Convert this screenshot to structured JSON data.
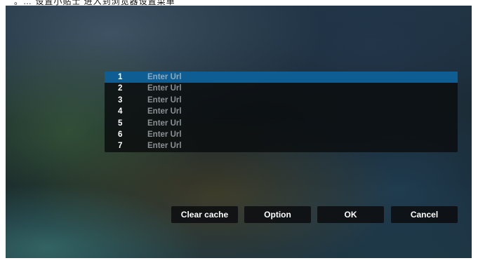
{
  "header_text": "。…  设置小贴士  进入到浏览器设置菜单",
  "url_list": {
    "items": [
      {
        "number": "1",
        "text": "Enter Url"
      },
      {
        "number": "2",
        "text": "Enter Url"
      },
      {
        "number": "3",
        "text": "Enter Url"
      },
      {
        "number": "4",
        "text": "Enter Url"
      },
      {
        "number": "5",
        "text": "Enter Url"
      },
      {
        "number": "6",
        "text": "Enter Url"
      },
      {
        "number": "7",
        "text": "Enter Url"
      }
    ],
    "selected_index": 0
  },
  "buttons": {
    "clear_cache": "Clear cache",
    "option": "Option",
    "ok": "OK",
    "cancel": "Cancel"
  },
  "colors": {
    "selection": "#0e5e94",
    "panel": "#0a0c0e",
    "label_text": "#8a8f93"
  }
}
